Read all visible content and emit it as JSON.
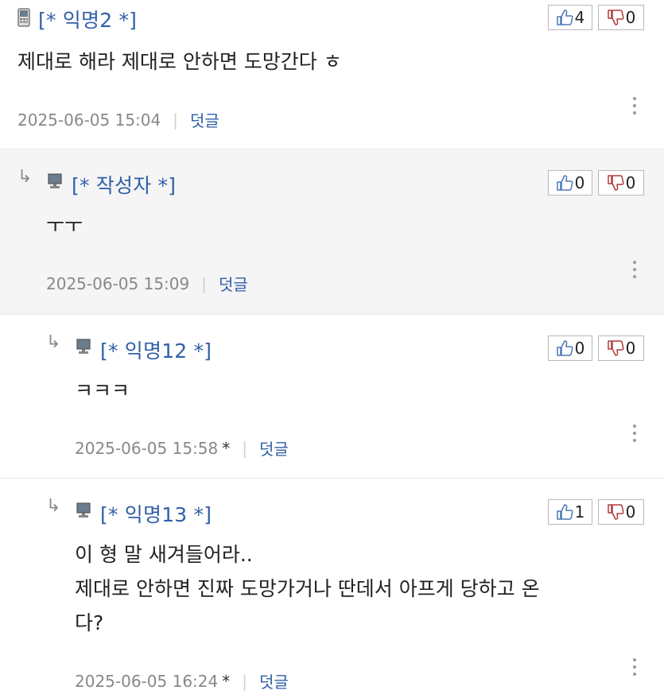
{
  "comments": [
    {
      "author": "[* 익명2 *]",
      "device": "mobile-phone-icon",
      "likes": "4",
      "dislikes": "0",
      "lines": [
        "제대로 해라 제대로 안하면 도망간다 ㅎ"
      ],
      "date": "2025-06-05 15:04",
      "starred": "",
      "reply_label": "덧글"
    },
    {
      "author": "[* 작성자 *]",
      "device": "monitor-icon",
      "likes": "0",
      "dislikes": "0",
      "lines": [
        "ㅜㅜ"
      ],
      "date": "2025-06-05 15:09",
      "starred": "",
      "reply_label": "덧글"
    },
    {
      "author": "[* 익명12 *]",
      "device": "monitor-icon",
      "likes": "0",
      "dislikes": "0",
      "lines": [
        "ㅋㅋㅋ"
      ],
      "date": "2025-06-05 15:58",
      "starred": "*",
      "reply_label": "덧글"
    },
    {
      "author": "[* 익명13 *]",
      "device": "monitor-icon",
      "likes": "1",
      "dislikes": "0",
      "lines": [
        "이 형 말 새겨들어라..",
        "제대로 안하면 진짜 도망가거나 딴데서 아프게 당하고 온",
        "다?"
      ],
      "date": "2025-06-05 16:24",
      "starred": "*",
      "reply_label": "덧글"
    }
  ],
  "colors": {
    "author": "#2f5fa8",
    "reply_link": "#2f5fa8",
    "like_icon": "#4a78b8",
    "dislike_icon": "#b03a3a",
    "highlight_bg": "#f5f5f5"
  }
}
